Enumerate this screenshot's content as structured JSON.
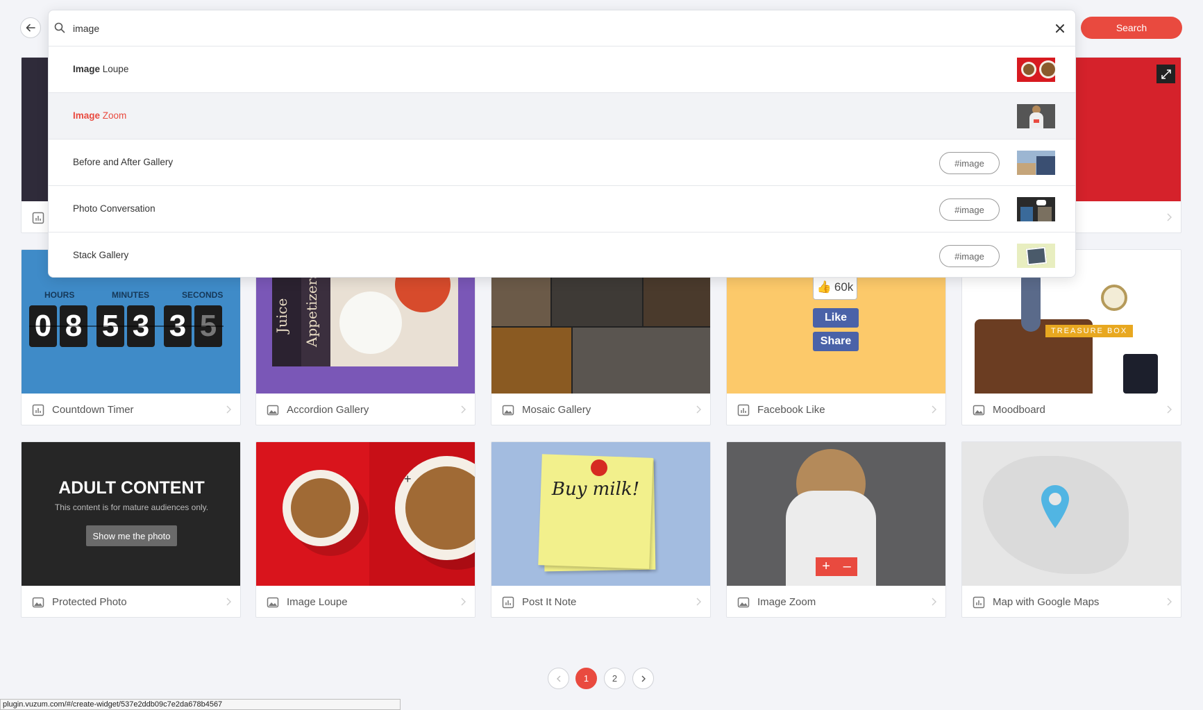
{
  "header": {
    "back_label": "back",
    "search_label": "Search",
    "search_value": "image",
    "accent": "#e94a3f"
  },
  "results": [
    {
      "bold": "Image",
      "rest": " Loupe",
      "tag": "",
      "active": false
    },
    {
      "bold": "Image",
      "rest": " Zoom",
      "tag": "",
      "active": true
    },
    {
      "bold": "",
      "rest": "Before and After Gallery",
      "tag": "#image",
      "active": false
    },
    {
      "bold": "",
      "rest": "Photo Conversation",
      "tag": "#image",
      "active": false
    },
    {
      "bold": "",
      "rest": "Stack Gallery",
      "tag": "#image",
      "active": false
    }
  ],
  "cards": [
    {
      "title": "Countdown Timer",
      "icon": "chart-icon"
    },
    {
      "title": "Accordion Gallery",
      "icon": "image-icon"
    },
    {
      "title": "Mosaic Gallery",
      "icon": "image-icon"
    },
    {
      "title": "Facebook Like",
      "icon": "chart-icon"
    },
    {
      "title": "Moodboard",
      "icon": "image-icon"
    },
    {
      "title": "Protected Photo",
      "icon": "image-icon"
    },
    {
      "title": "Image Loupe",
      "icon": "image-icon"
    },
    {
      "title": "Post It Note",
      "icon": "chart-icon"
    },
    {
      "title": "Image Zoom",
      "icon": "image-icon"
    },
    {
      "title": "Map with Google Maps",
      "icon": "chart-icon"
    }
  ],
  "thumbs": {
    "countdown": {
      "hours": "HOURS",
      "minutes": "MINUTES",
      "seconds": "SECONDS",
      "digits": [
        "0",
        "8",
        "5",
        "3",
        "3",
        "5"
      ]
    },
    "accordion": {
      "juice": "Juice",
      "appetizers": "Appetizers"
    },
    "facebook": {
      "count": "60k",
      "like": "Like",
      "share": "Share"
    },
    "moodboard": {
      "label": "TREASURE BOX"
    },
    "protected": {
      "title": "ADULT CONTENT",
      "subtitle": "This content is for mature audiences only.",
      "button": "Show me the photo"
    },
    "postit": {
      "text": "Buy milk!"
    }
  },
  "pagination": {
    "pages": [
      "1",
      "2"
    ],
    "current": "1"
  },
  "status_url": "plugin.vuzum.com/#/create-widget/537e2ddb09c7e2da678b4567"
}
